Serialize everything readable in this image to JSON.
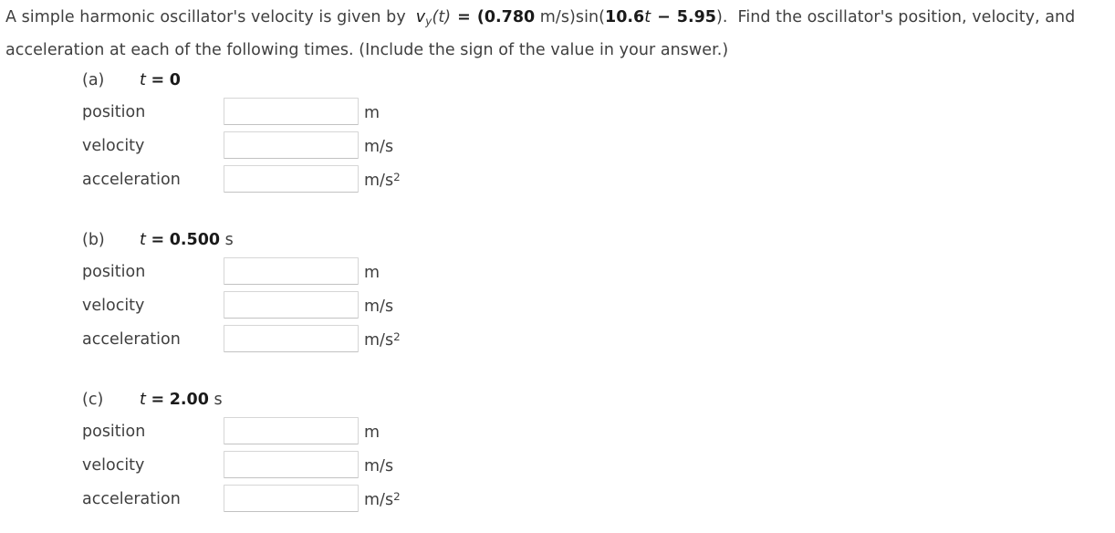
{
  "problem": {
    "intro_1": "A simple harmonic oscillator's velocity is given by",
    "velocity_symbol": "v",
    "velocity_subscript": "y",
    "velocity_arg": "(t)",
    "equals": "=",
    "amplitude_open": "(",
    "amplitude_value": "0.780",
    "amplitude_unit": "m/s",
    "amplitude_close": ")",
    "function_name": "sin(",
    "angular_frequency": "10.6",
    "time_symbol": "t",
    "minus_sign": "−",
    "phase_constant": "5.95",
    "function_close": ").",
    "intro_2": "Find the oscillator's position, velocity, and acceleration at each of the following times. (Include the sign of the value in your answer.)"
  },
  "parts": [
    {
      "letter": "(a)",
      "time_symbol": "t",
      "time_equals": "=",
      "time_value": "0",
      "time_unit": "",
      "rows": [
        {
          "label": "position",
          "value": "",
          "placeholder": "",
          "unit": "m",
          "unit_exponent": ""
        },
        {
          "label": "velocity",
          "value": "",
          "placeholder": "",
          "unit": "m/s",
          "unit_exponent": ""
        },
        {
          "label": "acceleration",
          "value": "",
          "placeholder": "",
          "unit": "m/s",
          "unit_exponent": "2"
        }
      ]
    },
    {
      "letter": "(b)",
      "time_symbol": "t",
      "time_equals": "=",
      "time_value": "0.500",
      "time_unit": "s",
      "rows": [
        {
          "label": "position",
          "value": "",
          "placeholder": "",
          "unit": "m",
          "unit_exponent": ""
        },
        {
          "label": "velocity",
          "value": "",
          "placeholder": "",
          "unit": "m/s",
          "unit_exponent": ""
        },
        {
          "label": "acceleration",
          "value": "",
          "placeholder": "",
          "unit": "m/s",
          "unit_exponent": "2"
        }
      ]
    },
    {
      "letter": "(c)",
      "time_symbol": "t",
      "time_equals": "=",
      "time_value": "2.00",
      "time_unit": "s",
      "rows": [
        {
          "label": "position",
          "value": "",
          "placeholder": "",
          "unit": "m",
          "unit_exponent": ""
        },
        {
          "label": "velocity",
          "value": "",
          "placeholder": "",
          "unit": "m/s",
          "unit_exponent": ""
        },
        {
          "label": "acceleration",
          "value": "",
          "placeholder": "",
          "unit": "m/s",
          "unit_exponent": "2"
        }
      ]
    }
  ],
  "colors": {
    "background": "#ffffff",
    "body_text": "#3f3f3f",
    "emphasis_text": "#1a1a1a",
    "input_border": "#d6d6d6"
  }
}
